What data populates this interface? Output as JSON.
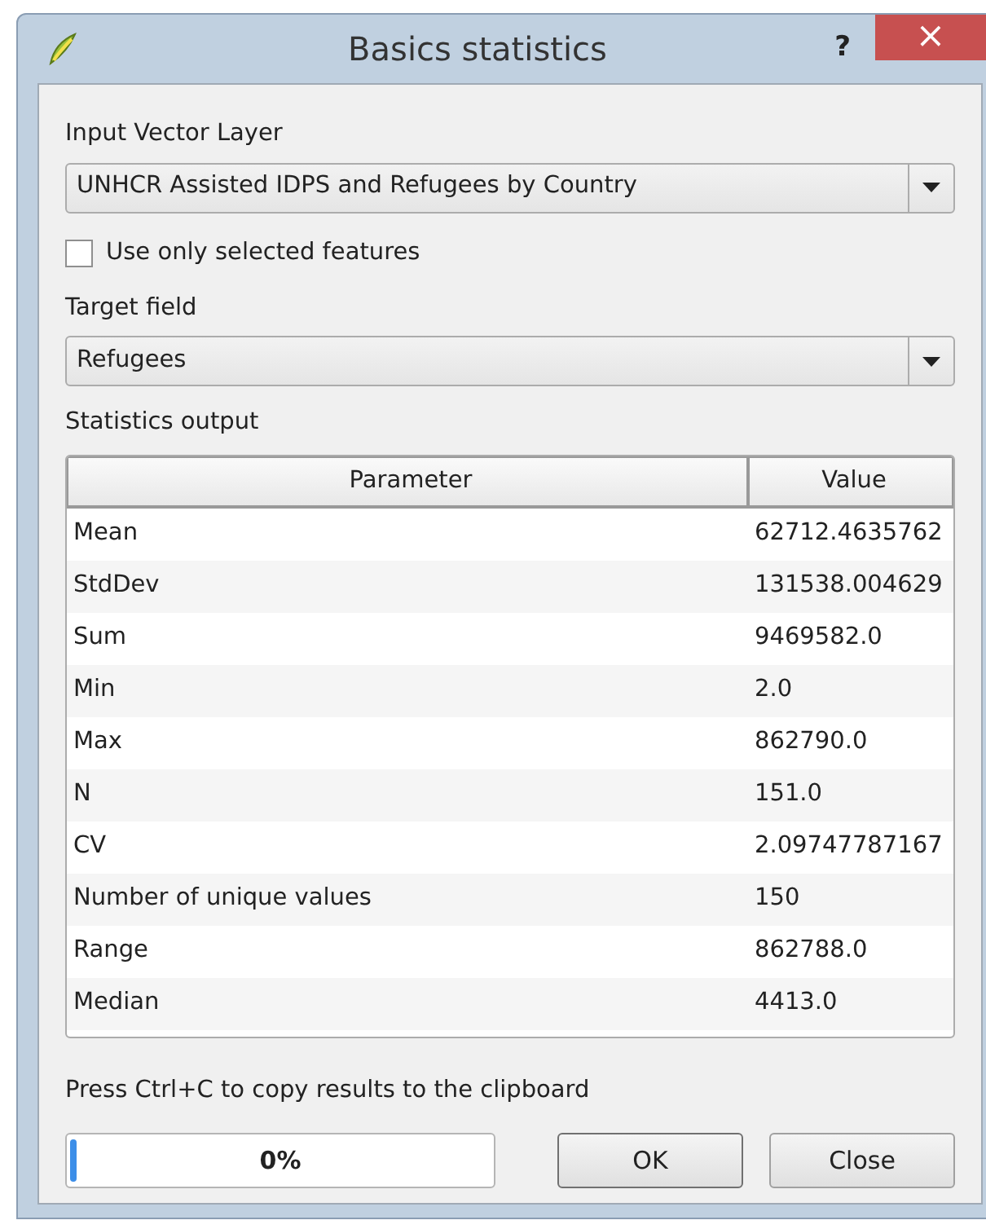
{
  "window": {
    "title": "Basics statistics",
    "help": "?",
    "close": "×"
  },
  "input_layer": {
    "label": "Input Vector Layer",
    "value": "UNHCR Assisted IDPS and Refugees by Country"
  },
  "selected_only": {
    "label": "Use only selected features",
    "checked": false
  },
  "target_field": {
    "label": "Target field",
    "value": "Refugees"
  },
  "statistics": {
    "label": "Statistics output",
    "columns": [
      "Parameter",
      "Value"
    ],
    "rows": [
      [
        "Mean",
        "62712.4635762"
      ],
      [
        "StdDev",
        "131538.004629"
      ],
      [
        "Sum",
        "9469582.0"
      ],
      [
        "Min",
        "2.0"
      ],
      [
        "Max",
        "862790.0"
      ],
      [
        "N",
        "151.0"
      ],
      [
        "CV",
        "2.09747787167"
      ],
      [
        "Number of unique values",
        "150"
      ],
      [
        "Range",
        "862788.0"
      ],
      [
        "Median",
        "4413.0"
      ]
    ]
  },
  "hint": "Press Ctrl+C to copy results to the clipboard",
  "progress": {
    "level": 0,
    "reading": "0%"
  },
  "buttons": [
    "OK",
    "Close"
  ]
}
